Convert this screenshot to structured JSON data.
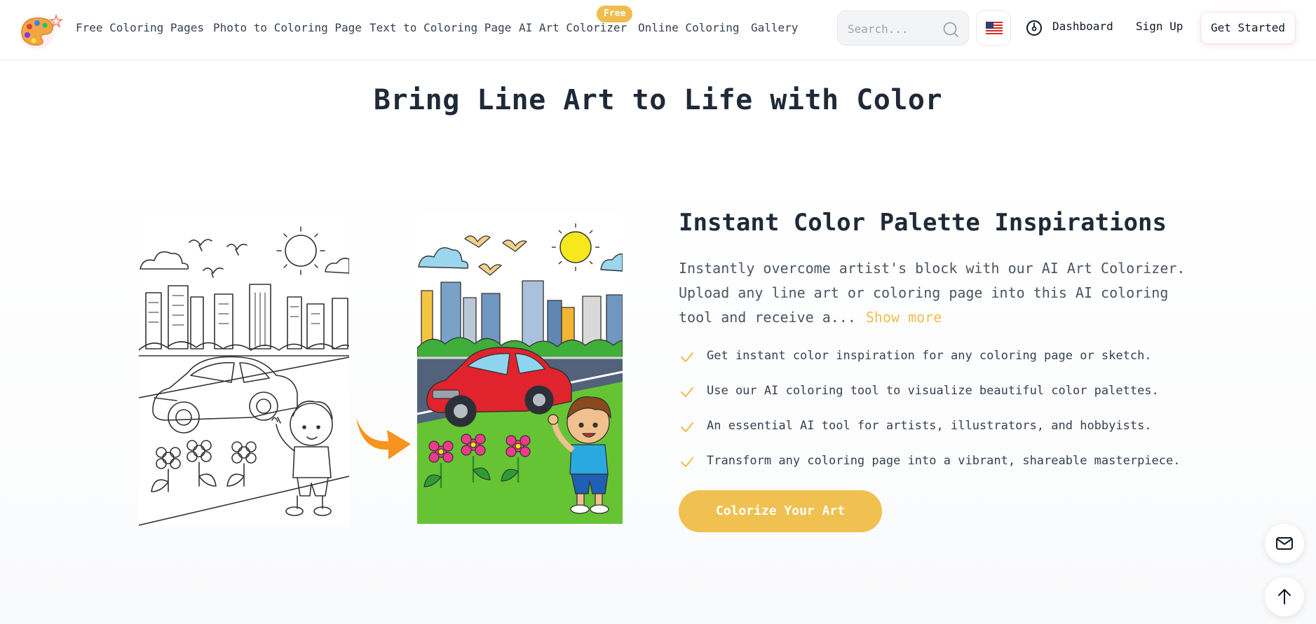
{
  "header": {
    "nav": [
      {
        "label": "Free Coloring Pages"
      },
      {
        "label": "Photo to Coloring Page"
      },
      {
        "label": "Text to Coloring Page"
      },
      {
        "label": "AI Art Colorizer",
        "badge": "Free"
      },
      {
        "label": "Online Coloring"
      },
      {
        "label": "Gallery"
      }
    ],
    "search": {
      "placeholder": "Search..."
    },
    "language_icon": "us-flag-icon",
    "dashboard_label": "Dashboard",
    "signup_label": "Sign Up",
    "get_started_label": "Get Started"
  },
  "hero": {
    "title": "Bring Line Art to Life with Color"
  },
  "feature": {
    "title": "Instant Color Palette Inspirations",
    "description": "Instantly overcome artist's block with our AI Art Colorizer. Upload any line art or coloring page into this AI coloring tool and receive a...",
    "show_more_label": "Show more",
    "bullets": [
      "Get instant color inspiration for any coloring page or sketch.",
      "Use our AI coloring tool to visualize beautiful color palettes.",
      "An essential AI tool for artists, illustrators, and hobbyists.",
      "Transform any coloring page into a vibrant, shareable masterpiece."
    ],
    "cta_label": "Colorize Your Art"
  },
  "colors": {
    "accent": "#f0bc4e",
    "text_dark": "#1f2937",
    "text_muted": "#4b5563"
  },
  "floating": {
    "mail_icon": "mail-icon",
    "scroll_top_icon": "arrow-up-icon"
  }
}
